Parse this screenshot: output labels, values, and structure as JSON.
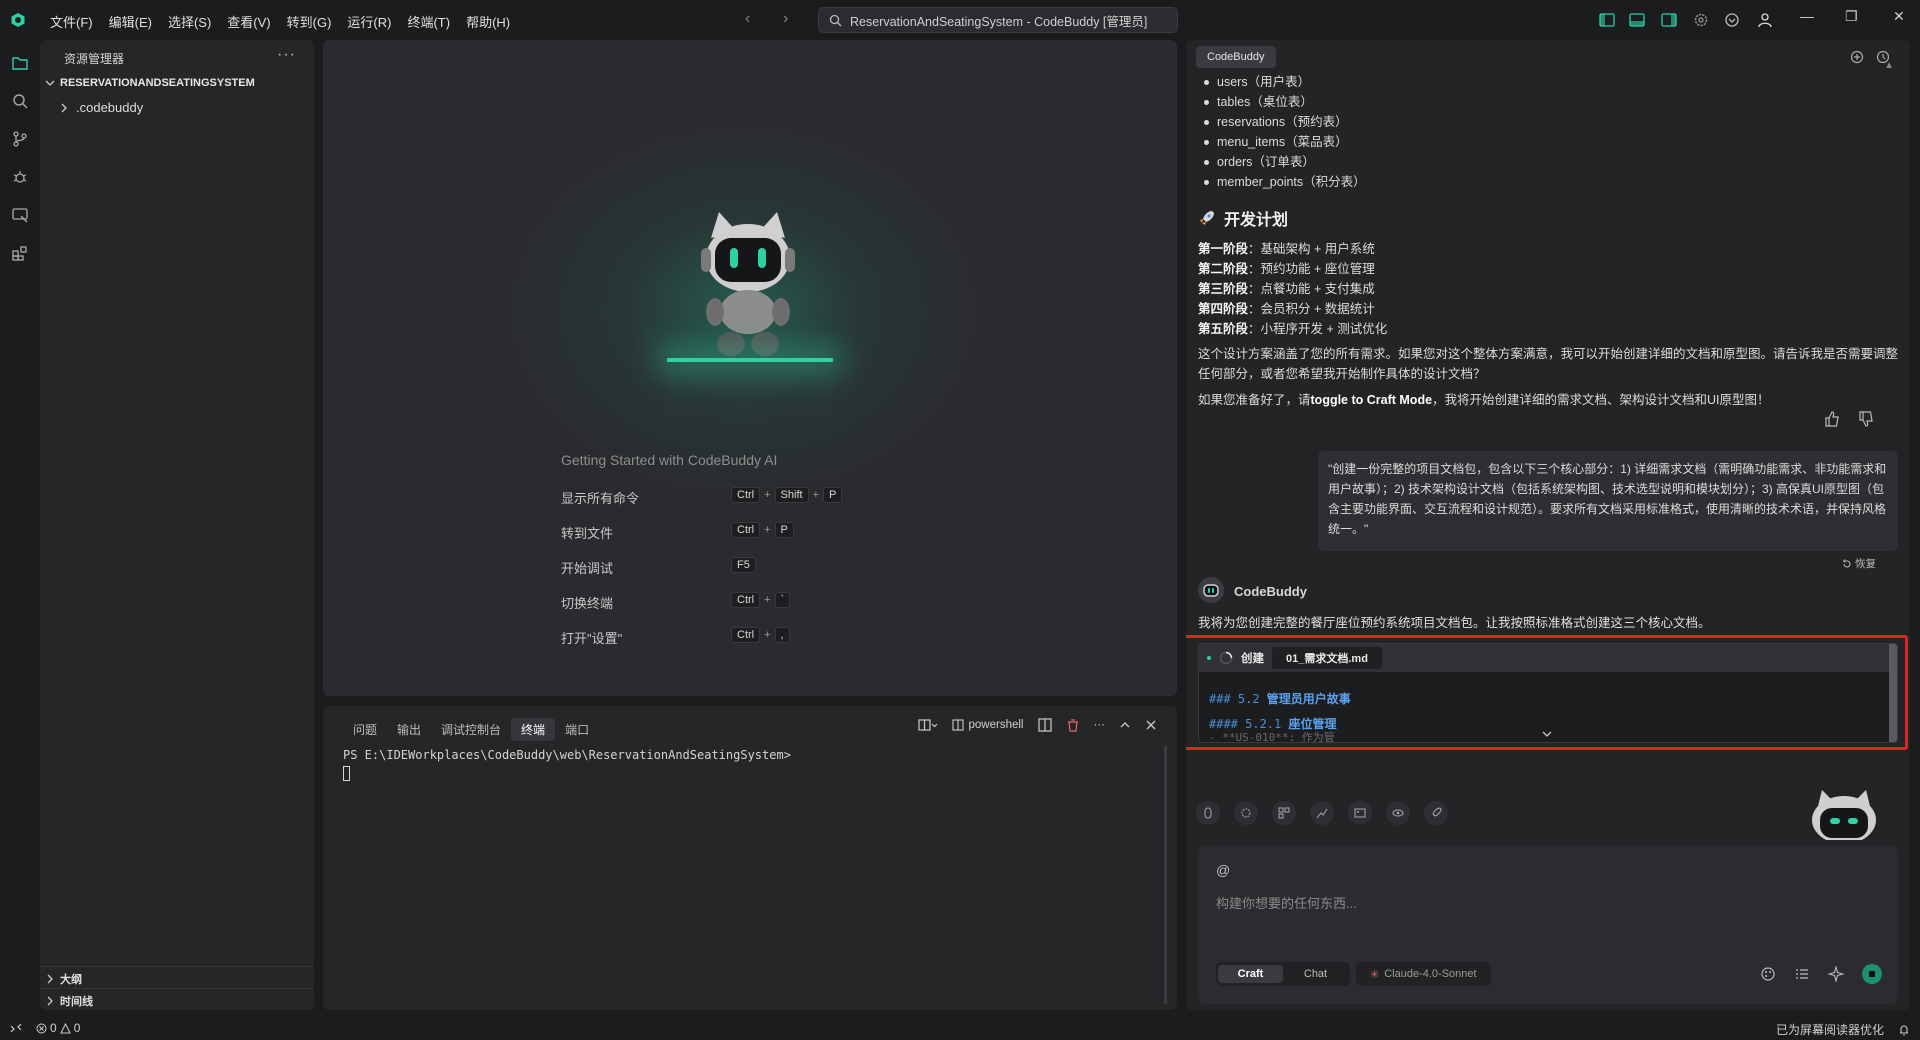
{
  "menu": [
    "文件(F)",
    "编辑(E)",
    "选择(S)",
    "查看(V)",
    "转到(G)",
    "运行(R)",
    "终端(T)",
    "帮助(H)"
  ],
  "command_center": "ReservationAndSeatingSystem - CodeBuddy [管理员]",
  "explorer": {
    "title": "资源管理器",
    "root": "RESERVATIONANDSEATINGSYSTEM",
    "items": [
      ".codebuddy"
    ],
    "outline": "大纲",
    "timeline": "时间线"
  },
  "welcome": {
    "title": "Getting Started with CodeBuddy AI",
    "shortcuts": [
      {
        "label": "显示所有命令",
        "keys": [
          "Ctrl",
          "Shift",
          "P"
        ]
      },
      {
        "label": "转到文件",
        "keys": [
          "Ctrl",
          "P"
        ]
      },
      {
        "label": "开始调试",
        "keys": [
          "F5"
        ]
      },
      {
        "label": "切换终端",
        "keys": [
          "Ctrl",
          "`"
        ]
      },
      {
        "label": "打开\"设置\"",
        "keys": [
          "Ctrl",
          ","
        ]
      }
    ]
  },
  "panel": {
    "tabs": [
      "问题",
      "输出",
      "调试控制台",
      "终端",
      "端口"
    ],
    "active_tab": "终端",
    "shell": "powershell",
    "prompt": "PS E:\\IDEWorkplaces\\CodeBuddy\\web\\ReservationAndSeatingSystem>"
  },
  "chat": {
    "tab": "CodeBuddy",
    "tables": [
      "users（用户表）",
      "tables（桌位表）",
      "reservations（预约表）",
      "menu_items（菜品表）",
      "orders（订单表）",
      "member_points（积分表）"
    ],
    "plan_heading": "开发计划",
    "phases": [
      {
        "label": "第一阶段",
        "text": "：基础架构 + 用户系统"
      },
      {
        "label": "第二阶段",
        "text": "：预约功能 + 座位管理"
      },
      {
        "label": "第三阶段",
        "text": "：点餐功能 + 支付集成"
      },
      {
        "label": "第四阶段",
        "text": "：会员积分 + 数据统计"
      },
      {
        "label": "第五阶段",
        "text": "：小程序开发 + 测试优化"
      }
    ],
    "para1": "这个设计方案涵盖了您的所有需求。如果您对这个整体方案满意，我可以开始创建详细的文档和原型图。请告诉我是否需要调整任何部分，或者您希望我开始制作具体的设计文档？",
    "para2_a": "如果您准备好了，请",
    "para2_b": "toggle to Craft Mode",
    "para2_c": "，我将开始创建详细的需求文档、架构设计文档和UI原型图！",
    "user_message": "\"创建一份完整的项目文档包，包含以下三个核心部分：1) 详细需求文档（需明确功能需求、非功能需求和用户故事）；2) 技术架构设计文档（包括系统架构图、技术选型说明和模块划分）；3) 高保真UI原型图（包含主要功能界面、交互流程和设计规范）。要求所有文档采用标准格式，使用清晰的技术术语，并保持风格统一。\"",
    "restore": "恢复",
    "assistant_name": "CodeBuddy",
    "assistant_msg": "我将为您创建完整的餐厅座位预约系统项目文档包。让我按照标准格式创建这三个核心文档。",
    "card": {
      "action": "创建",
      "file": "01_需求文档.md",
      "line1_hash": "### 5.2 ",
      "line1_text": "管理员用户故事",
      "line2_hash": "#### 5.2.1 ",
      "line2_text": "座位管理",
      "line3": "- **US-010**: 作为管"
    },
    "input": {
      "at": "@",
      "placeholder": "构建你想要的任何东西...",
      "mode_craft": "Craft",
      "mode_chat": "Chat",
      "active_mode": "Craft",
      "model": "Claude-4.0-Sonnet"
    }
  },
  "status": {
    "errors": "0",
    "warnings": "0",
    "screen_reader": "已为屏幕阅读器优化"
  },
  "colors": {
    "accent": "#2fd1a3",
    "highlight": "#e02424"
  }
}
